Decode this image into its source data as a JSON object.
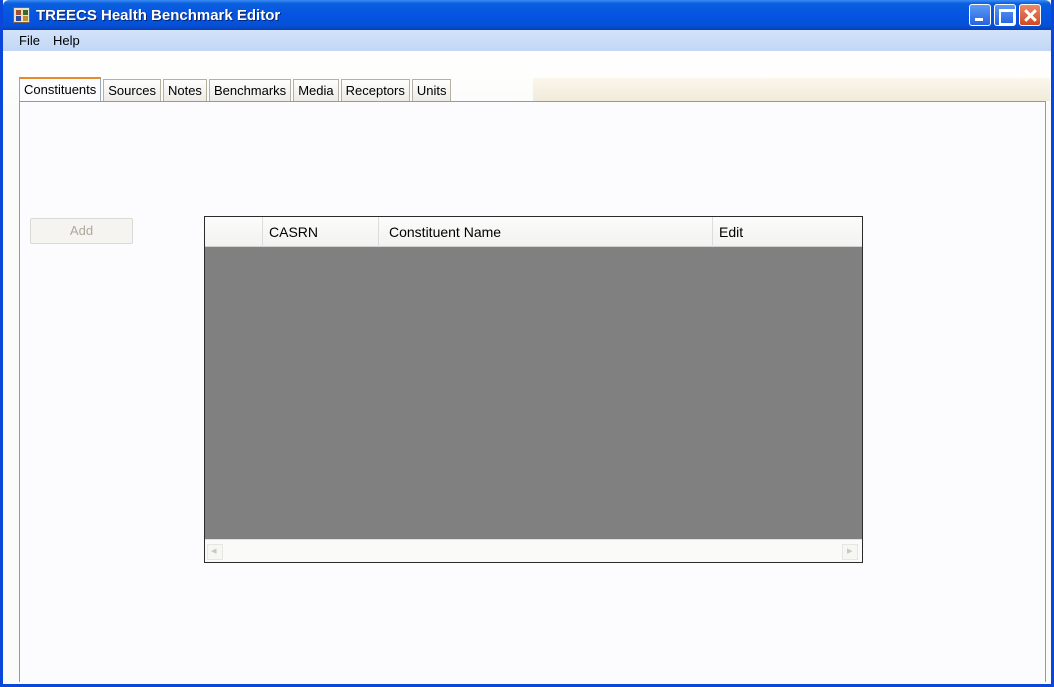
{
  "window": {
    "title": "TREECS Health Benchmark Editor",
    "titlebar_color": "#0554e3"
  },
  "menu": {
    "items": [
      {
        "label": "File"
      },
      {
        "label": "Help"
      }
    ]
  },
  "tabs": [
    {
      "label": "Constituents",
      "active": true
    },
    {
      "label": "Sources",
      "active": false
    },
    {
      "label": "Notes",
      "active": false
    },
    {
      "label": "Benchmarks",
      "active": false
    },
    {
      "label": "Media",
      "active": false
    },
    {
      "label": "Receptors",
      "active": false
    },
    {
      "label": "Units",
      "active": false
    }
  ],
  "constituents": {
    "add_label": "Add",
    "add_enabled": false,
    "grid": {
      "columns": [
        "",
        "CASRN",
        "Constituent Name",
        "Edit"
      ],
      "rows": [],
      "body_color": "#808080"
    }
  },
  "icons": {
    "app": "app-icon",
    "minimize": "minimize-icon",
    "maximize": "maximize-icon",
    "close": "close-icon",
    "scroll_left": "scroll-left-arrow-icon",
    "scroll_right": "scroll-right-arrow-icon"
  }
}
